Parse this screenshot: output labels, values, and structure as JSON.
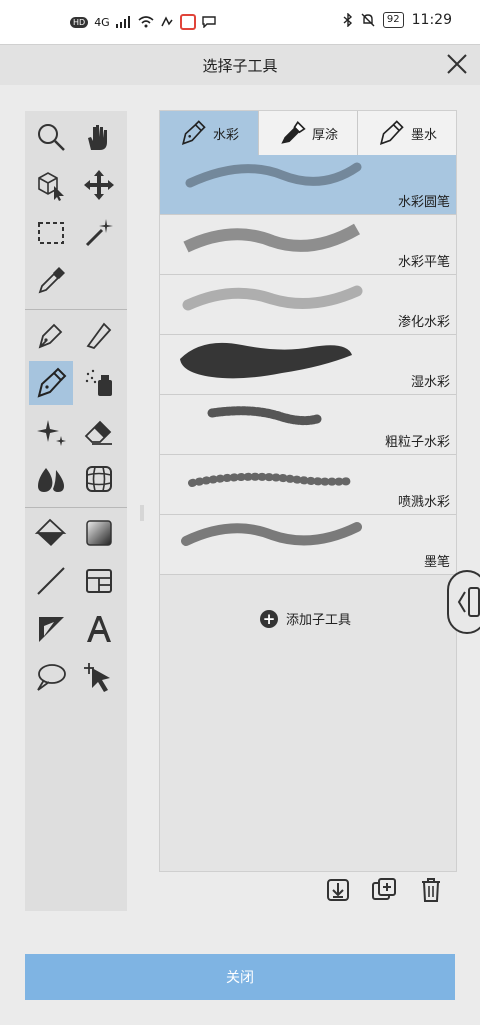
{
  "status_bar": {
    "network_label": "HD",
    "signal_label": "4G",
    "battery": "92",
    "time": "11:29"
  },
  "dialog": {
    "title": "选择子工具"
  },
  "tabs": [
    {
      "label": "水彩",
      "icon": "watercolor-brush-icon"
    },
    {
      "label": "厚涂",
      "icon": "oil-paint-tube-icon"
    },
    {
      "label": "墨水",
      "icon": "ink-pen-icon"
    }
  ],
  "subtools": [
    {
      "label": "水彩圆笔",
      "selected": true
    },
    {
      "label": "水彩平笔",
      "selected": false
    },
    {
      "label": "渗化水彩",
      "selected": false
    },
    {
      "label": "湿水彩",
      "selected": false
    },
    {
      "label": "粗粒子水彩",
      "selected": false
    },
    {
      "label": "喷溅水彩",
      "selected": false
    },
    {
      "label": "墨笔",
      "selected": false
    }
  ],
  "add_subtool_label": "添加子工具",
  "close_button_label": "关闭",
  "tools": [
    "zoom-icon",
    "hand-icon",
    "3d-move-icon",
    "move-icon",
    "rect-select-icon",
    "magic-wand-icon",
    "eyedropper-icon",
    "pen-icon",
    "pencil-icon",
    "brush-icon",
    "airbrush-icon",
    "decoration-icon",
    "eraser-icon",
    "blend-icon",
    "mesh-icon",
    "fill-icon",
    "gradient-icon",
    "line-icon",
    "frame-icon",
    "ruler-icon",
    "text-icon",
    "balloon-icon",
    "selection-arrow-icon"
  ],
  "colors": {
    "accent": "#a8c6e0",
    "button": "#7fb4e3",
    "panel": "#ebebeb"
  }
}
